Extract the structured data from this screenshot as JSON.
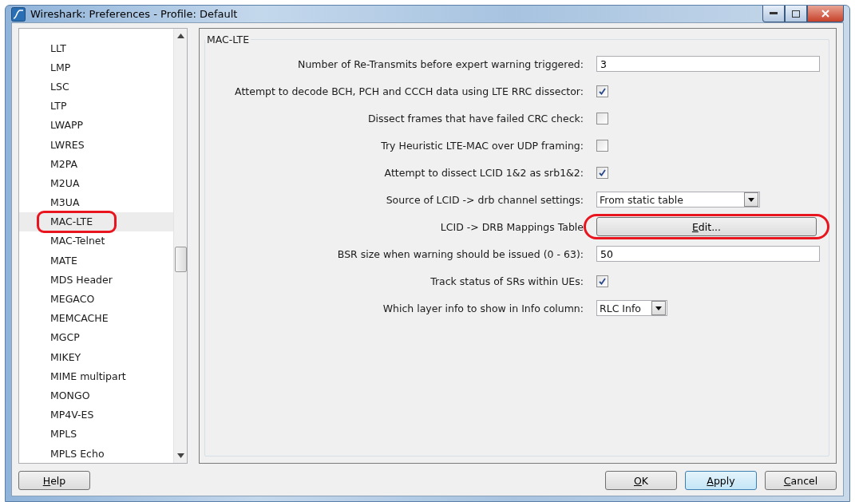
{
  "window": {
    "title": "Wireshark: Preferences - Profile: Default"
  },
  "protocols": [
    {
      "label": "LLT",
      "selected": false,
      "highlighted": false
    },
    {
      "label": "LMP",
      "selected": false,
      "highlighted": false
    },
    {
      "label": "LSC",
      "selected": false,
      "highlighted": false
    },
    {
      "label": "LTP",
      "selected": false,
      "highlighted": false
    },
    {
      "label": "LWAPP",
      "selected": false,
      "highlighted": false
    },
    {
      "label": "LWRES",
      "selected": false,
      "highlighted": false
    },
    {
      "label": "M2PA",
      "selected": false,
      "highlighted": false
    },
    {
      "label": "M2UA",
      "selected": false,
      "highlighted": false
    },
    {
      "label": "M3UA",
      "selected": false,
      "highlighted": false
    },
    {
      "label": "MAC-LTE",
      "selected": true,
      "highlighted": true
    },
    {
      "label": "MAC-Telnet",
      "selected": false,
      "highlighted": false
    },
    {
      "label": "MATE",
      "selected": false,
      "highlighted": false
    },
    {
      "label": "MDS Header",
      "selected": false,
      "highlighted": false
    },
    {
      "label": "MEGACO",
      "selected": false,
      "highlighted": false
    },
    {
      "label": "MEMCACHE",
      "selected": false,
      "highlighted": false
    },
    {
      "label": "MGCP",
      "selected": false,
      "highlighted": false
    },
    {
      "label": "MIKEY",
      "selected": false,
      "highlighted": false
    },
    {
      "label": "MIME multipart",
      "selected": false,
      "highlighted": false
    },
    {
      "label": "MONGO",
      "selected": false,
      "highlighted": false
    },
    {
      "label": "MP4V-ES",
      "selected": false,
      "highlighted": false
    },
    {
      "label": "MPLS",
      "selected": false,
      "highlighted": false
    },
    {
      "label": "MPLS Echo",
      "selected": false,
      "highlighted": false
    }
  ],
  "group": {
    "title": "MAC-LTE",
    "settings": [
      {
        "kind": "text",
        "label": "Number of Re-Transmits before expert warning triggered:",
        "value": "3"
      },
      {
        "kind": "checkbox",
        "label": "Attempt to decode BCH, PCH and CCCH data using LTE RRC dissector:",
        "checked": true
      },
      {
        "kind": "checkbox",
        "label": "Dissect frames that have failed CRC check:",
        "checked": false
      },
      {
        "kind": "checkbox",
        "label": "Try Heuristic LTE-MAC over UDP framing:",
        "checked": false
      },
      {
        "kind": "checkbox",
        "label": "Attempt to dissect LCID 1&2 as srb1&2:",
        "checked": true
      },
      {
        "kind": "combo",
        "label": "Source of LCID -> drb channel settings:",
        "value": "From static table",
        "wide": true
      },
      {
        "kind": "button",
        "label": "LCID -> DRB Mappings Table",
        "button": "Edit...",
        "highlighted": true
      },
      {
        "kind": "text",
        "label": "BSR size when warning should be issued (0 - 63):",
        "value": "50"
      },
      {
        "kind": "checkbox",
        "label": "Track status of SRs within UEs:",
        "checked": true
      },
      {
        "kind": "combo",
        "label": "Which layer info to show in Info column:",
        "value": "RLC Info",
        "wide": false
      }
    ]
  },
  "buttons": [
    {
      "label": "Help",
      "default": false
    },
    {
      "label": "OK",
      "default": false
    },
    {
      "label": "Apply",
      "default": true
    },
    {
      "label": "Cancel",
      "default": false
    }
  ]
}
